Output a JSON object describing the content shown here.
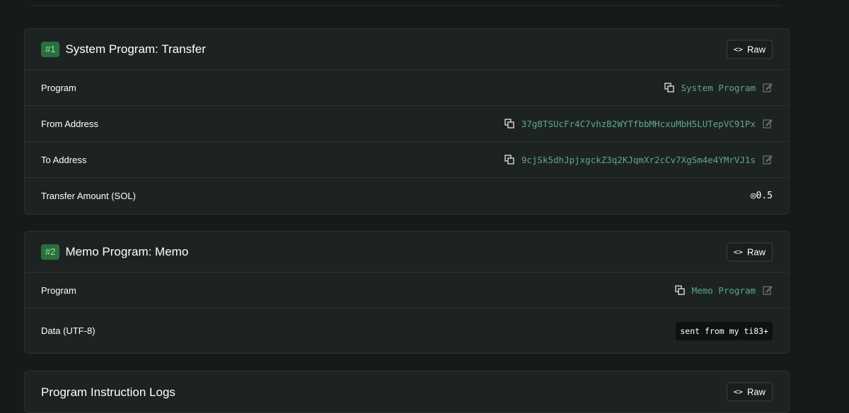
{
  "instructions": [
    {
      "badge": "#1",
      "title": "System Program: Transfer",
      "raw_label": "Raw",
      "rows": [
        {
          "label": "Program",
          "value": "System Program"
        },
        {
          "label": "From Address",
          "value": "37g8TSUcFr4C7vhzB2WYTfbbMHcxuMbH5LUTepVC91Px"
        },
        {
          "label": "To Address",
          "value": "9cjSk5dhJpjxgckZ3q2KJqmXr2cCv7XgSm4e4YMrVJ1s"
        },
        {
          "label": "Transfer Amount (SOL)",
          "value": "◎0.5"
        }
      ]
    },
    {
      "badge": "#2",
      "title": "Memo Program: Memo",
      "raw_label": "Raw",
      "rows": [
        {
          "label": "Program",
          "value": "Memo Program"
        },
        {
          "label": "Data (UTF-8)",
          "value": "sent from my ti83+"
        }
      ]
    }
  ],
  "logs": {
    "title": "Program Instruction Logs",
    "raw_label": "Raw"
  },
  "colors": {
    "background": "#161a19",
    "card": "#1d2322",
    "link": "#5fa889",
    "badge_bg": "#2b6f3f",
    "badge_text": "#9fe1a8"
  },
  "icons": {
    "copy": "copy-icon",
    "edit": "edit-icon",
    "code": "code-icon"
  }
}
